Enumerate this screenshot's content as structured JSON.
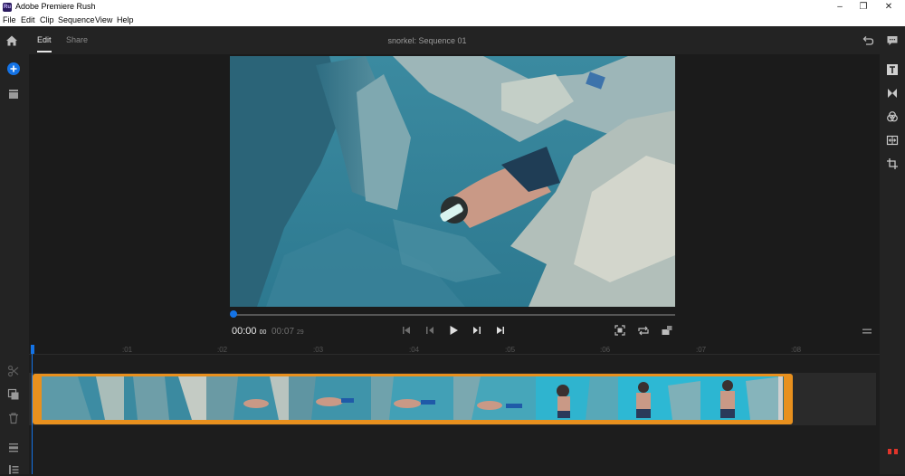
{
  "window": {
    "app_icon_text": "Ru",
    "title": "Adobe Premiere Rush",
    "minimize": "–",
    "maximize": "❐",
    "close": "✕"
  },
  "menu": [
    "File",
    "Edit",
    "Clip",
    "Sequence",
    "View",
    "Help"
  ],
  "topbar": {
    "tabs": [
      "Edit",
      "Share"
    ],
    "active_tab": "Edit",
    "sequence_title": "snorkel: Sequence 01"
  },
  "player": {
    "current_time": "00:00",
    "current_frames": "00",
    "duration": "00:07",
    "duration_frames": "29",
    "progress": 0.0
  },
  "ruler": {
    "ticks": [
      ":01",
      ":02",
      ":03",
      ":04",
      ":05",
      ":06",
      ":07",
      ":08"
    ]
  },
  "icons": {
    "home": "home-icon",
    "undo": "undo-icon",
    "comment": "comment-icon",
    "add": "add-icon",
    "media": "media-icon",
    "titles": "titles-icon",
    "transitions": "transitions-icon",
    "color": "color-icon",
    "speed": "speed-icon",
    "transform": "crop-icon"
  },
  "colors": {
    "accent_blue": "#1473e6",
    "clip_orange": "#e8901e",
    "meter_red": "#e0352b"
  }
}
